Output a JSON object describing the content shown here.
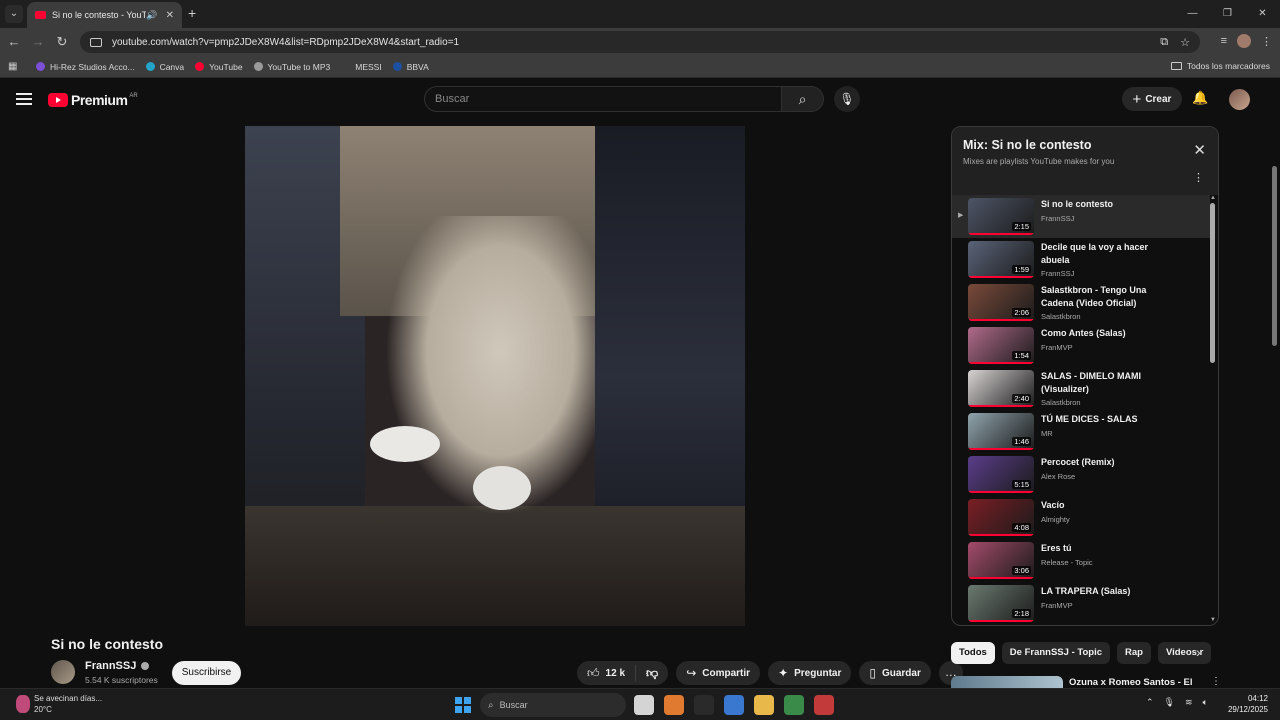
{
  "browser": {
    "tab_title": "Si no le contesto - YouTube",
    "url": "youtube.com/watch?v=pmp2JDeX8W4&list=RDpmp2JDeX8W4&start_radio=1",
    "bookmarks": [
      {
        "label": "Hi-Rez Studios Acco...",
        "color": "#7b4fd6"
      },
      {
        "label": "Canva",
        "color": "#24a4c8"
      },
      {
        "label": "YouTube",
        "color": "#ff0033"
      },
      {
        "label": "YouTube to MP3",
        "color": "#9a9a9a"
      },
      {
        "label": "MESSI",
        "color": "#3c3c3c"
      },
      {
        "label": "BBVA",
        "color": "#1d4fa0"
      }
    ],
    "all_bookmarks_label": "Todos los marcadores"
  },
  "youtube": {
    "logo_text": "Premium",
    "country_code": "AR",
    "search_placeholder": "Buscar",
    "create_label": "Crear"
  },
  "video": {
    "title": "Si no le contesto",
    "channel": "FrannSSJ",
    "subscribers": "5.54 K suscriptores",
    "subscribe_label": "Suscribirse",
    "likes": "12 k",
    "share_label": "Compartir",
    "ask_label": "Preguntar",
    "save_label": "Guardar"
  },
  "mix": {
    "title": "Mix: Si no le contesto",
    "subtitle": "Mixes are playlists YouTube makes for you",
    "items": [
      {
        "title": "Si no le contesto",
        "channel": "FrannSSJ",
        "duration": "2:15",
        "active": true,
        "thumb": "#4d5566"
      },
      {
        "title": "Decile que la voy a hacer abuela",
        "channel": "FrannSSJ",
        "duration": "1:59",
        "active": false,
        "thumb": "#5a6378"
      },
      {
        "title": "Salastkbron - Tengo Una Cadena (Video Oficial)",
        "channel": "Salastkbron",
        "duration": "2:06",
        "active": false,
        "thumb": "#7a4a3a"
      },
      {
        "title": "Como Antes (Salas)",
        "channel": "FranMVP",
        "duration": "1:54",
        "active": false,
        "thumb": "#b06a8a"
      },
      {
        "title": "SALAS - DIMELO MAMI (Visualizer)",
        "channel": "Salastkbron",
        "duration": "2:40",
        "active": false,
        "thumb": "#d9d4d4"
      },
      {
        "title": "TÚ ME DICES - SALAS",
        "channel": "MR",
        "duration": "1:46",
        "active": false,
        "thumb": "#8fa4ac"
      },
      {
        "title": "Percocet (Remix)",
        "channel": "Alex Rose",
        "duration": "5:15",
        "active": false,
        "thumb": "#5a3d8a"
      },
      {
        "title": "Vacío",
        "channel": "Almighty",
        "duration": "4:08",
        "active": false,
        "thumb": "#7a1e24"
      },
      {
        "title": "Eres tú",
        "channel": "Release - Topic",
        "duration": "3:06",
        "active": false,
        "thumb": "#a44b6a"
      },
      {
        "title": "LA TRAPERA (Salas)",
        "channel": "FranMVP",
        "duration": "2:18",
        "active": false,
        "thumb": "#6a7a70"
      }
    ]
  },
  "chips": [
    "Todos",
    "De FrannSSJ - Topic",
    "Rap",
    "Videos r"
  ],
  "recommendation": {
    "title": "Ozuna x Romeo Santos - El"
  },
  "taskbar": {
    "weather_text": "Se avecinan días...",
    "temperature": "20°C",
    "search_label": "Buscar",
    "time": "04:12",
    "date": "29/12/2025",
    "apps": [
      "#d4d4d4",
      "#e07a30",
      "#2a2a2a",
      "#3a78d0",
      "#e8b84a",
      "#3a8a4a",
      "#c23a3a"
    ]
  }
}
